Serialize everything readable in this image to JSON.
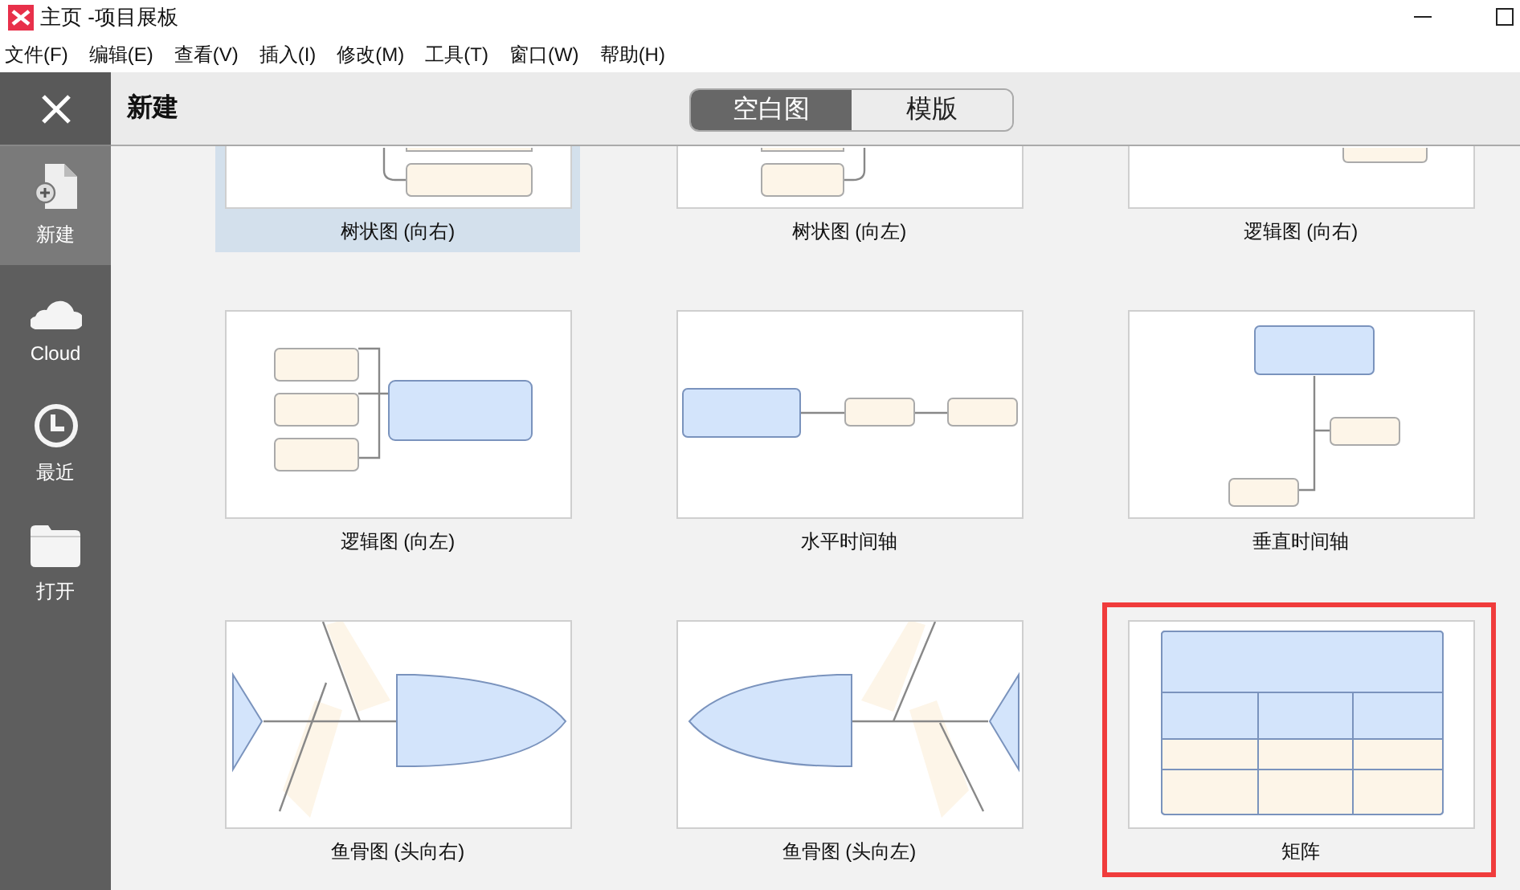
{
  "window": {
    "title": "主页 -项目展板"
  },
  "menu": [
    "文件(F)",
    "编辑(E)",
    "查看(V)",
    "插入(I)",
    "修改(M)",
    "工具(T)",
    "窗口(W)",
    "帮助(H)"
  ],
  "sidebar": {
    "items": [
      {
        "kind": "new",
        "label": "新建",
        "selected": true
      },
      {
        "kind": "cloud",
        "label": "Cloud",
        "selected": false
      },
      {
        "kind": "recent",
        "label": "最近",
        "selected": false
      },
      {
        "kind": "open",
        "label": "打开",
        "selected": false
      }
    ]
  },
  "header": {
    "title": "新建",
    "tabs": [
      {
        "label": "空白图",
        "selected": true
      },
      {
        "label": "模版",
        "selected": false
      }
    ]
  },
  "templates": [
    {
      "kind": "tree-right",
      "label": "树状图 (向右)",
      "selected": true
    },
    {
      "kind": "tree-left",
      "label": "树状图 (向左)",
      "selected": false
    },
    {
      "kind": "logic-right",
      "label": "逻辑图 (向右)",
      "selected": false
    },
    {
      "kind": "logic-left",
      "label": "逻辑图 (向左)",
      "selected": false
    },
    {
      "kind": "timeline-h",
      "label": "水平时间轴",
      "selected": false
    },
    {
      "kind": "timeline-v",
      "label": "垂直时间轴",
      "selected": false
    },
    {
      "kind": "fish-right",
      "label": "鱼骨图 (头向右)",
      "selected": false
    },
    {
      "kind": "fish-left",
      "label": "鱼骨图 (头向左)",
      "selected": false
    },
    {
      "kind": "matrix",
      "label": "矩阵",
      "selected": false,
      "highlighted": true
    }
  ]
}
